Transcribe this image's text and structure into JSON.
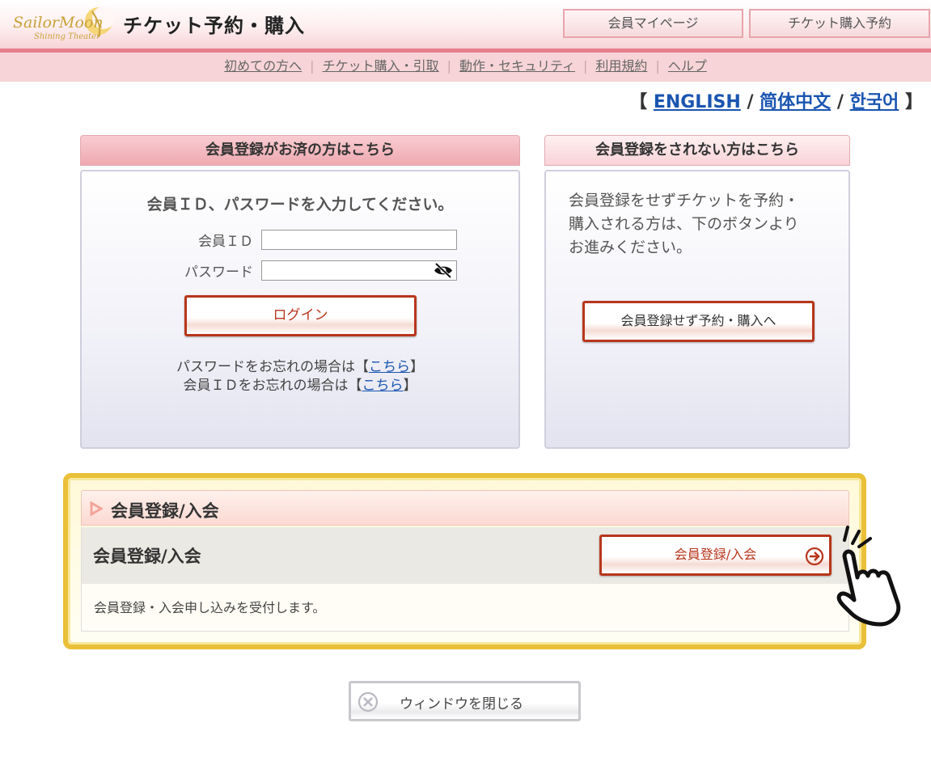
{
  "header": {
    "logo_text": "Sailor Moon Shining Theater",
    "title": "チケット予約・購入",
    "mypage_button": "会員マイページ",
    "ticket_button": "チケット購入予約"
  },
  "subnav": {
    "items": [
      "初めての方へ",
      "チケット購入・引取",
      "動作・セキュリティ",
      "利用規約",
      "ヘルプ"
    ],
    "separator": "|"
  },
  "languages": {
    "open_bracket": "【",
    "close_bracket": "】",
    "slash": "/",
    "english": "ENGLISH",
    "chinese": "简体中文",
    "korean": "한국어"
  },
  "member_panel": {
    "heading": "会員登録がお済の方はこちら",
    "prompt": "会員ＩＤ、パスワードを入力してください。",
    "id_label": "会員ＩＤ",
    "password_label": "パスワード",
    "id_value": "",
    "password_value": "",
    "login_button": "ログイン",
    "forgot_password_prefix": "パスワードをお忘れの場合は【",
    "forgot_id_prefix": "会員ＩＤをお忘れの場合は【",
    "link_text": "こちら",
    "suffix": "】"
  },
  "guest_panel": {
    "heading": "会員登録をされない方はこちら",
    "description": "会員登録をせずチケットを予約・購入される方は、下のボタンよりお進みください。",
    "button": "会員登録せず予約・購入へ"
  },
  "registration": {
    "section_title": "会員登録/入会",
    "row_title": "会員登録/入会",
    "button": "会員登録/入会",
    "description": "会員登録・入会申し込みを受付します。"
  },
  "close_window": "ウィンドウを閉じる",
  "colors": {
    "header_pink": "#f7d4d7",
    "accent_red": "#b8361c",
    "gold": "#e9c038",
    "link_blue": "#1a55b0"
  }
}
